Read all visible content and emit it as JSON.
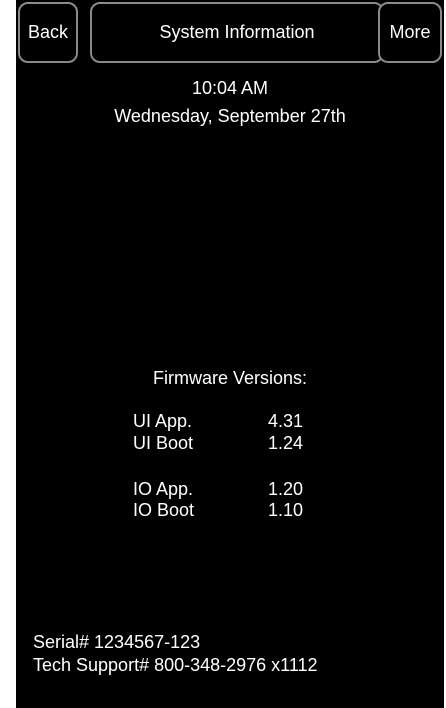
{
  "header": {
    "back_label": "Back",
    "title": "System Information",
    "more_label": "More"
  },
  "clock": {
    "time": "10:04 AM",
    "date": "Wednesday, September 27th"
  },
  "firmware": {
    "heading": "Firmware Versions:",
    "rows": [
      {
        "label": "UI App.",
        "value": "4.31"
      },
      {
        "label": "UI Boot",
        "value": "1.24"
      },
      {
        "label": "IO App.",
        "value": "1.20"
      },
      {
        "label": "IO Boot",
        "value": "1.10"
      }
    ]
  },
  "footer": {
    "serial": "Serial# 1234567-123",
    "tech_support": "Tech Support# 800-348-2976 x1112"
  }
}
